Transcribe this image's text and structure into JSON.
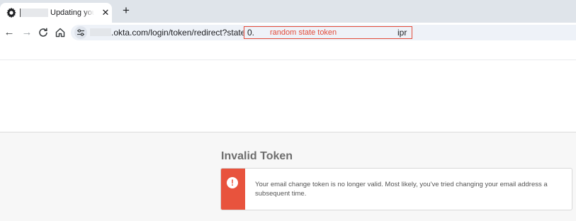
{
  "browser": {
    "tab": {
      "title": "Updating your email",
      "close_glyph": "✕",
      "favicon": "gear-icon"
    },
    "new_tab_glyph": "+",
    "nav": {
      "back_glyph": "←",
      "forward_glyph": "→",
      "reload_glyph": "C"
    },
    "address_bar": {
      "url_text": ".okta.com/login/token/redirect?stateToken=",
      "token_prefix": "0.",
      "token_label": "random state token",
      "token_suffix": "ipr"
    }
  },
  "page": {
    "heading": "Invalid Token",
    "alert": {
      "icon_glyph": "!",
      "message": "Your email change token is no longer valid. Most likely, you've tried changing your email address a subsequent time."
    }
  },
  "colors": {
    "accent_red": "#e8533d",
    "annotation_red": "#e34b3a",
    "tabstrip": "#dfe4ea",
    "omnibox": "#eef2f8",
    "page_background": "#f7f7f7"
  }
}
